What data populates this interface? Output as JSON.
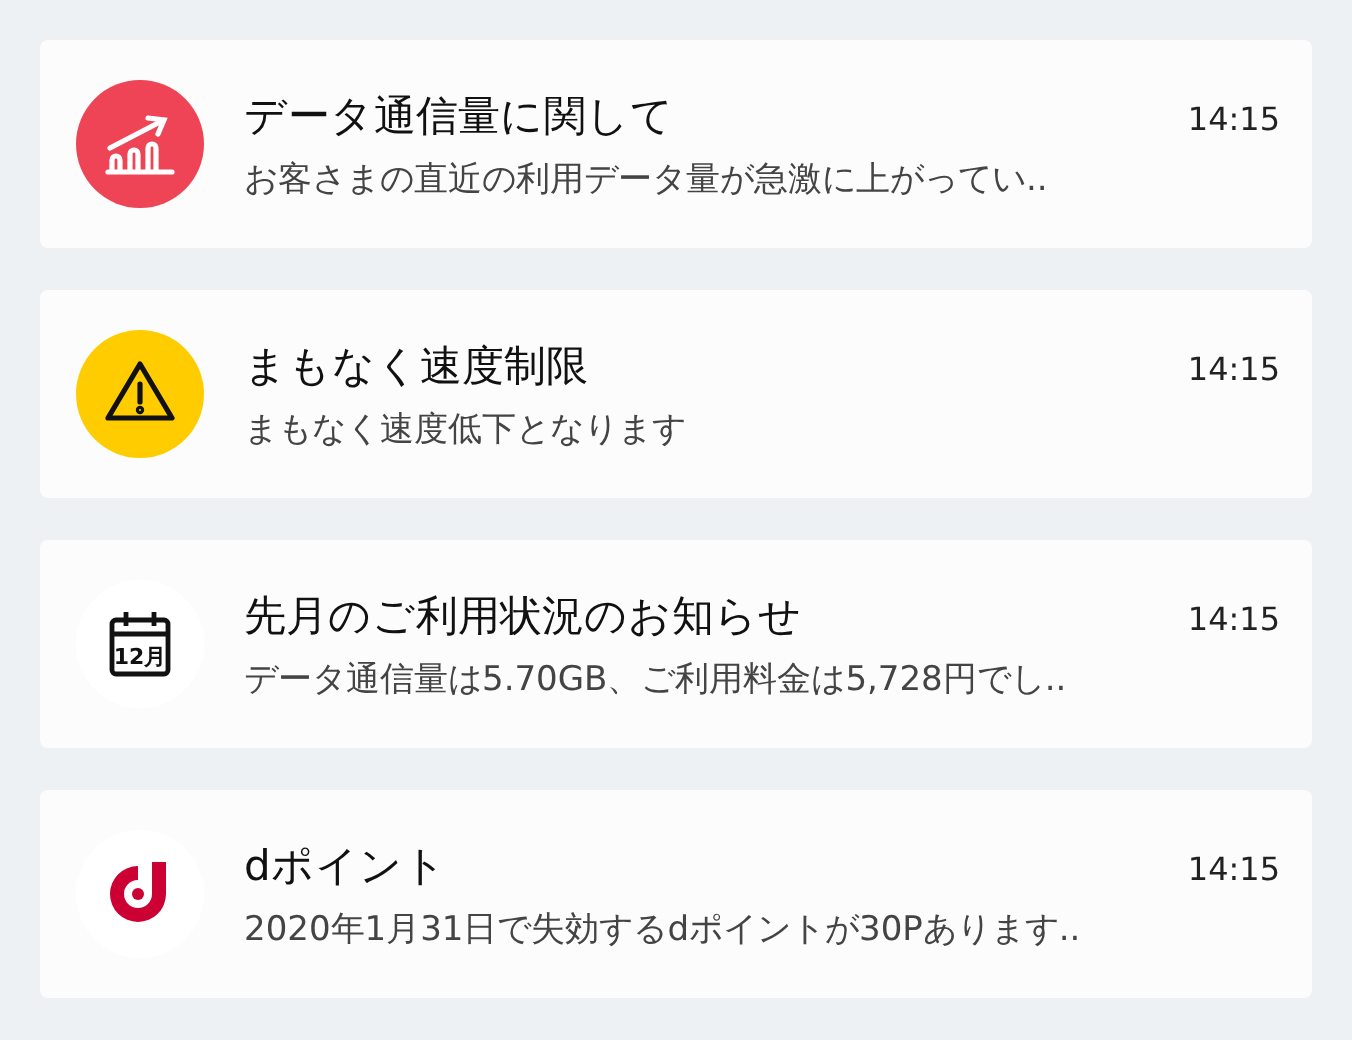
{
  "notifications": [
    {
      "kind": "chart",
      "title": "データ通信量に関して",
      "time": "14:15",
      "body": "お客さまの直近の利用データ量が急激に上がってい.."
    },
    {
      "kind": "warning",
      "title": "まもなく速度制限",
      "time": "14:15",
      "body": "まもなく速度低下となります"
    },
    {
      "kind": "calendar",
      "icon_text": "12月",
      "title": "先月のご利用状況のお知らせ",
      "time": "14:15",
      "body": "データ通信量は5.70GB、ご利用料金は5,728円でし.."
    },
    {
      "kind": "dpoint",
      "title": "dポイント",
      "time": "14:15",
      "body": "2020年1月31日で失効するdポイントが30Pあります.."
    }
  ]
}
